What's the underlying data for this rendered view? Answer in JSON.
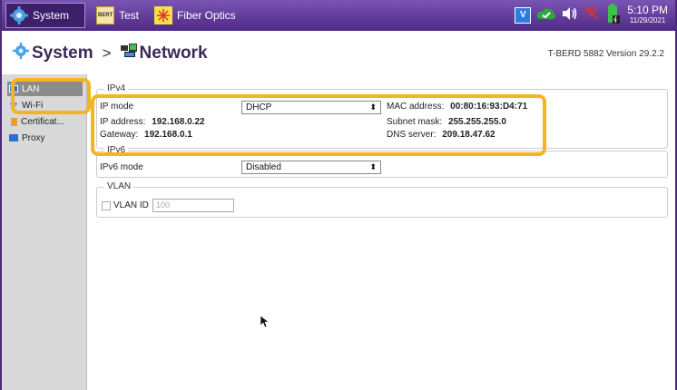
{
  "topbar": {
    "tabs": [
      {
        "label": "System",
        "icon": "gear-icon"
      },
      {
        "label": "Test",
        "icon": "bert-icon",
        "icon_text": "BERT"
      },
      {
        "label": "Fiber Optics",
        "icon": "fiber-icon"
      }
    ],
    "status": {
      "badge": "V",
      "time": "5:10 PM",
      "date": "11/29/2021"
    }
  },
  "header": {
    "breadcrumb_root": "System",
    "breadcrumb_sep": ">",
    "breadcrumb_page": "Network",
    "version": "T-BERD 5882 Version 29.2.2"
  },
  "sidebar": {
    "items": [
      {
        "label": "LAN"
      },
      {
        "label": "Wi-Fi"
      },
      {
        "label": "Certificat..."
      },
      {
        "label": "Proxy"
      }
    ]
  },
  "ipv4": {
    "legend": "IPv4",
    "mode_label": "IP mode",
    "mode_value": "DHCP",
    "mac_label": "MAC address:",
    "mac_value": "00:80:16:93:D4:71",
    "ip_label": "IP address:",
    "ip_value": "192.168.0.22",
    "subnet_label": "Subnet mask:",
    "subnet_value": "255.255.255.0",
    "gateway_label": "Gateway:",
    "gateway_value": "192.168.0.1",
    "dns_label": "DNS server:",
    "dns_value": "209.18.47.62"
  },
  "ipv6": {
    "legend": "IPv6",
    "mode_label": "IPv6 mode",
    "mode_value": "Disabled"
  },
  "vlan": {
    "legend": "VLAN",
    "id_label": "VLAN ID",
    "id_placeholder": "100"
  },
  "colors": {
    "topbar": "#5b3594",
    "highlight": "#f5b520",
    "sidebar": "#d9d9d9"
  }
}
